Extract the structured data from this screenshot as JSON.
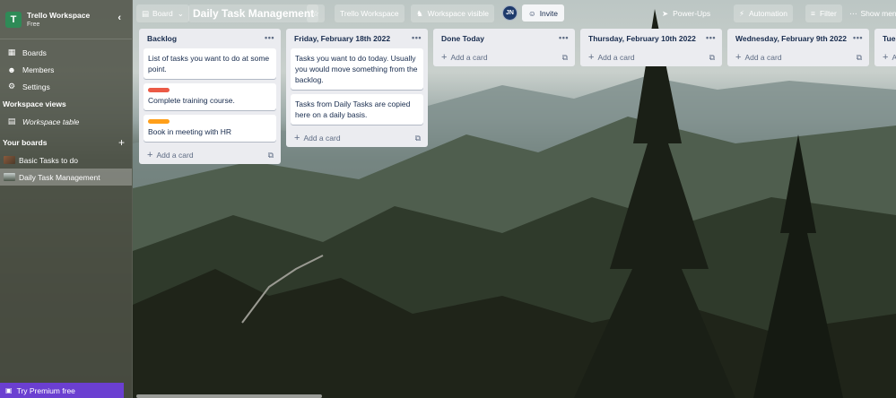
{
  "colors": {
    "sidebar_bg": "#4e5246",
    "workspace_avatar": "#2e8b57",
    "premium": "#6b3fd1",
    "label_red": "#eb5a46",
    "label_orange": "#ff9f1a",
    "list_bg": "#ebecf0"
  },
  "sidebar": {
    "workspace_initial": "T",
    "workspace_name": "Trello Workspace",
    "workspace_plan": "Free",
    "collapse_icon": "chevron-left-icon",
    "nav": [
      {
        "label": "Boards",
        "icon": "board-icon"
      },
      {
        "label": "Members",
        "icon": "person-icon"
      },
      {
        "label": "Settings",
        "icon": "gear-icon"
      }
    ],
    "views_heading": "Workspace views",
    "views": [
      {
        "label": "Workspace table",
        "icon": "table-icon"
      }
    ],
    "boards_heading": "Your boards",
    "boards": [
      {
        "label": "Basic Tasks to do",
        "active": false
      },
      {
        "label": "Daily Task Management",
        "active": true
      }
    ],
    "premium_label": "Try Premium free"
  },
  "topbar": {
    "view_label": "Board",
    "board_title": "Daily Task Management",
    "workspace_btn": "Trello Workspace",
    "visibility_btn": "Workspace visible",
    "avatar_initials": "JN",
    "invite_label": "Invite",
    "powerups_label": "Power-Ups",
    "automation_label": "Automation",
    "filter_label": "Filter",
    "show_menu_label": "Show menu"
  },
  "lists": [
    {
      "title": "Backlog",
      "cards": [
        {
          "text": "List of tasks you want to do at some point.",
          "label_color": null
        },
        {
          "text": "Complete training course.",
          "label_color": "#eb5a46"
        },
        {
          "text": "Book in meeting with HR",
          "label_color": "#ff9f1a"
        }
      ],
      "add_label": "Add a card"
    },
    {
      "title": "Friday, February 18th 2022",
      "cards": [
        {
          "text": "Tasks you want to do today. Usually you would move something from the backlog.",
          "label_color": null
        },
        {
          "text": "Tasks from Daily Tasks are copied here on a daily basis.",
          "label_color": null
        }
      ],
      "add_label": "Add a card"
    },
    {
      "title": "Done Today",
      "cards": [],
      "add_label": "Add a card"
    },
    {
      "title": "Thursday, February 10th 2022",
      "cards": [],
      "add_label": "Add a card"
    },
    {
      "title": "Wednesday, February 9th 2022",
      "cards": [],
      "add_label": "Add a card"
    },
    {
      "title": "Tues",
      "cards": [],
      "add_label": "A"
    }
  ]
}
